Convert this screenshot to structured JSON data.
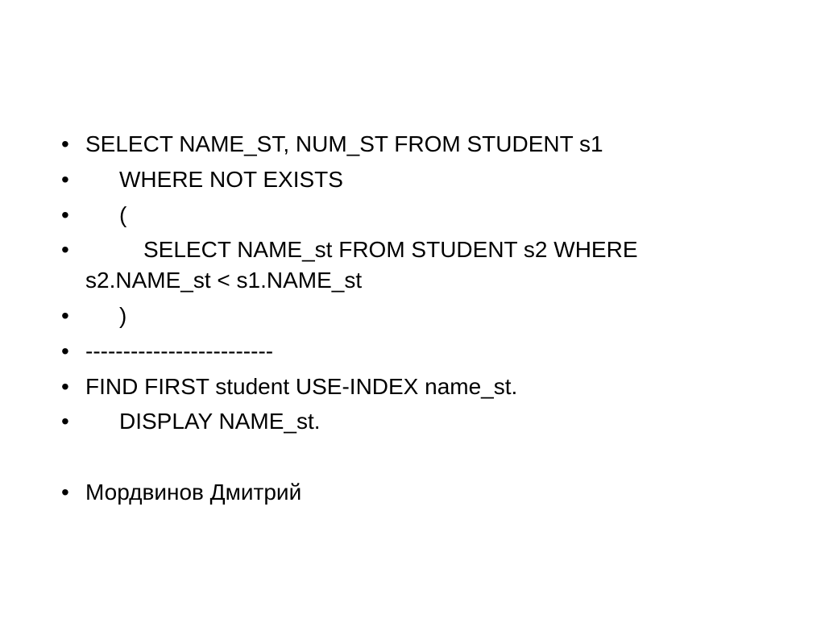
{
  "slide": {
    "items": [
      {
        "text": "SELECT NAME_ST, NUM_ST FROM STUDENT s1",
        "indent": 0
      },
      {
        "text": "WHERE NOT EXISTS",
        "indent": 1
      },
      {
        "text": "(",
        "indent": 1
      },
      {
        "text": "SELECT NAME_st FROM STUDENT s2 WHERE s2.NAME_st < s1.NAME_st",
        "indent": 2
      },
      {
        "text": ")",
        "indent": 1
      },
      {
        "text": "-------------------------",
        "indent": 0
      },
      {
        "text": "FIND FIRST student USE-INDEX name_st.",
        "indent": 0
      },
      {
        "text": "DISPLAY NAME_st.",
        "indent": 1
      },
      {
        "text": "",
        "indent": 0,
        "blank": true
      },
      {
        "text": "Мордвинов Дмитрий",
        "indent": 0
      }
    ]
  }
}
